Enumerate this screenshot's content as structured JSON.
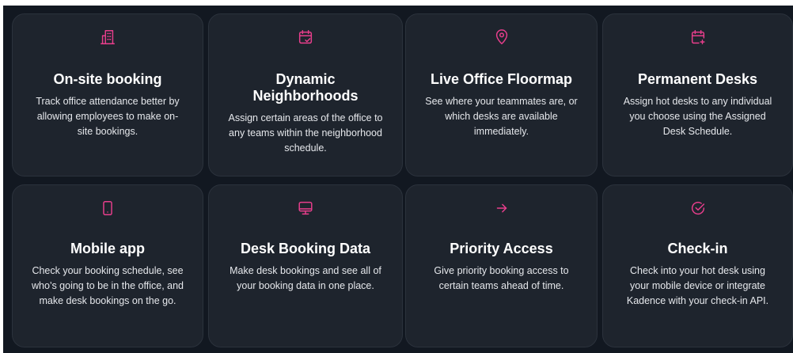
{
  "accent_color": "#e83e8c",
  "cards": [
    {
      "icon": "building-icon",
      "title": "On-site booking",
      "description": "Track office attendance better by allowing employees to make on-site bookings."
    },
    {
      "icon": "calendar-check-icon",
      "title": "Dynamic Neighborhoods",
      "description": "Assign certain areas of the office to any teams within the neighborhood schedule."
    },
    {
      "icon": "map-pin-icon",
      "title": "Live Office Floormap",
      "description": "See where your teammates are, or which desks are available immediately."
    },
    {
      "icon": "calendar-plus-icon",
      "title": "Permanent Desks",
      "description": "Assign hot desks to any individual you choose using the Assigned Desk Schedule."
    },
    {
      "icon": "smartphone-icon",
      "title": "Mobile app",
      "description": "Check your booking schedule, see who’s going to be in the office, and make desk bookings on the go."
    },
    {
      "icon": "monitor-icon",
      "title": "Desk Booking Data",
      "description": "Make desk bookings and see all of your booking data in one place."
    },
    {
      "icon": "arrow-right-icon",
      "title": "Priority Access",
      "description": "Give priority booking access to certain teams ahead of time."
    },
    {
      "icon": "check-circle-icon",
      "title": "Check-in",
      "description": "Check into your hot desk using your mobile device or integrate Kadence with your check-in API."
    }
  ]
}
